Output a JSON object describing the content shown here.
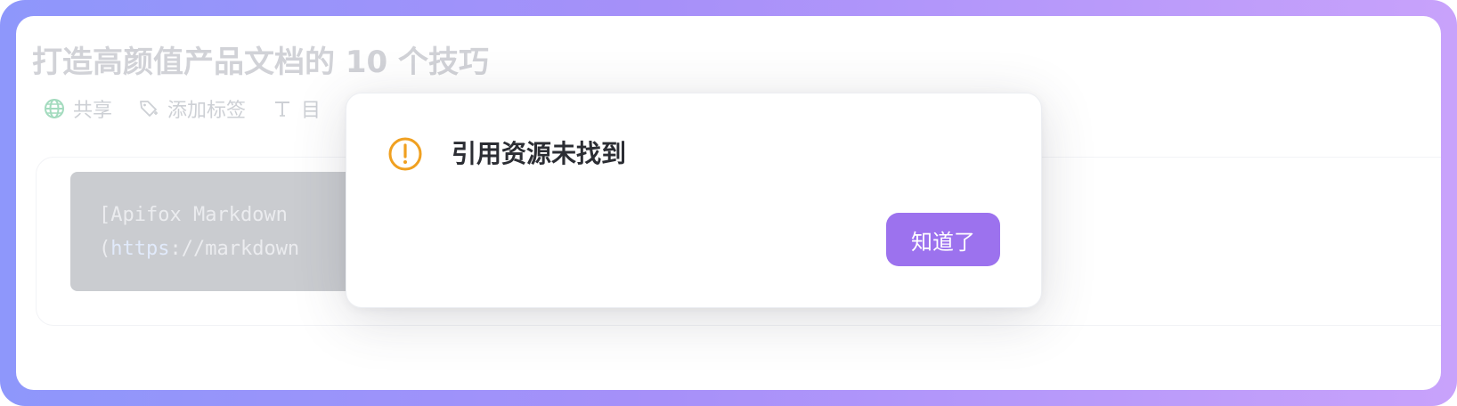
{
  "document": {
    "title": "打造高颜值产品文档的 10 个技巧"
  },
  "meta_bar": {
    "share_label": "共享",
    "add_tag_label": "添加标签",
    "toc_label": "目",
    "icons": [
      "globe-icon",
      "tag-icon",
      "text-icon"
    ]
  },
  "content": {
    "code_line_1": "[Apifox Markdown",
    "code_line_2_open": "(",
    "code_line_2_link": "https",
    "code_line_2_rest": "://markdown"
  },
  "dialog": {
    "title": "引用资源未找到",
    "icon": "warning-circle-icon",
    "confirm_label": "知道了"
  },
  "colors": {
    "accent": "#9c72ee",
    "warning": "#f0a020",
    "globe": "#8fd3b0"
  }
}
